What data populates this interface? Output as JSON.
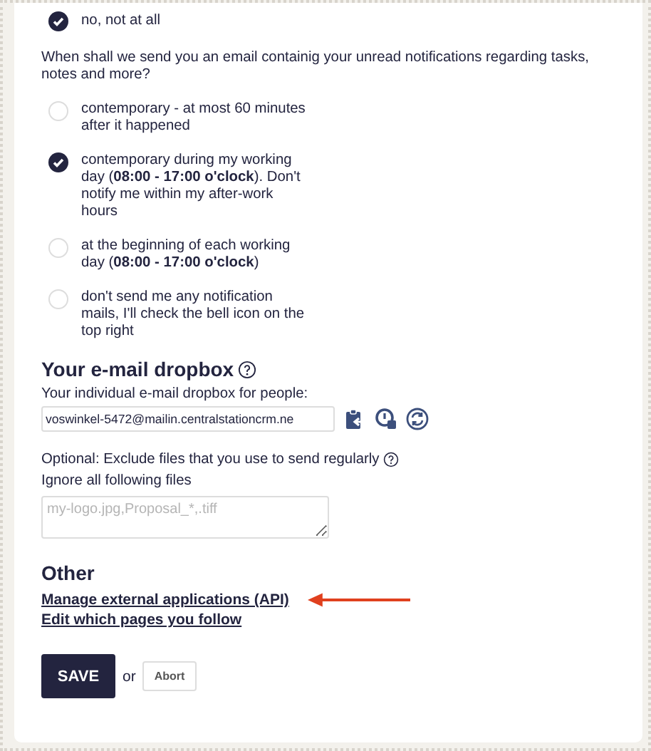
{
  "previous_option": {
    "label": "no, not at all",
    "selected": true
  },
  "notification_question": "When shall we send you an email containig your unread notifications regarding tasks, notes and more?",
  "notification_options": [
    {
      "label": "contemporary - at most 60 minutes after it happened",
      "selected": false
    },
    {
      "label": "contemporary during my working day (**08:00 - 17:00 o'clock**). Don't notify me within my after-work hours",
      "selected": true
    },
    {
      "label": "at the beginning of each working day (**08:00 - 17:00 o'clock**)",
      "selected": false
    },
    {
      "label": "don't send me any notification mails, I'll check the bell icon on the top right",
      "selected": false
    }
  ],
  "dropbox": {
    "heading": "Your e-mail dropbox",
    "field_label": "Your individual e-mail dropbox for people:",
    "address": "voswinkel-5472@mailin.centralstationcrm.ne",
    "exclude_label": "Optional: Exclude files that you use to send regularly",
    "ignore_label": "Ignore all following files",
    "ignore_placeholder": "my-logo.jpg,Proposal_*,.tiff"
  },
  "other": {
    "heading": "Other",
    "links": [
      "Manage external applications (API)",
      "Edit which pages you follow"
    ]
  },
  "actions": {
    "save": "SAVE",
    "separator": "or",
    "abort": "Abort"
  }
}
